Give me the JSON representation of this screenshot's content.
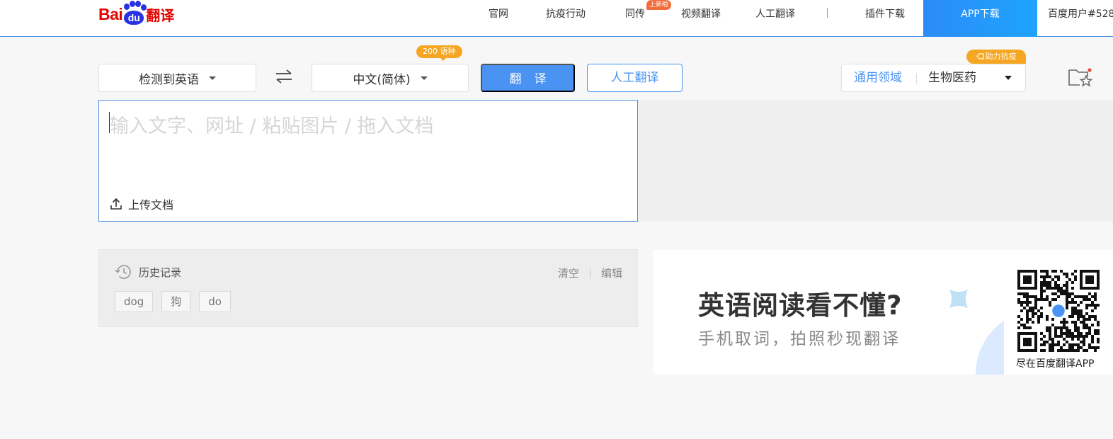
{
  "header": {
    "logo": {
      "bai": "Bai",
      "du": "du",
      "fanyi": "翻译"
    },
    "nav": [
      {
        "label": "官网"
      },
      {
        "label": "抗疫行动"
      },
      {
        "label": "同传",
        "badge": "上新啦"
      },
      {
        "label": "视频翻译"
      },
      {
        "label": "人工翻译"
      }
    ],
    "plugin_download": "插件下载",
    "app_download": "APP下载",
    "user": "百度用户#528",
    "accent_color": "#4a93f2"
  },
  "toolbar": {
    "source_lang": "检测到英语",
    "swap_icon": "swap-arrows-icon",
    "target_lang": "中文(简体)",
    "lang_count_badge": "200 语种",
    "translate_button": "翻译",
    "human_translate_button": "人工翻译",
    "domain": {
      "general": "通用领域",
      "selected": "生物医药"
    },
    "domain_badge": "助力抗疫",
    "favorites_icon": "folder-star-icon"
  },
  "input": {
    "placeholder": "输入文字、网址 / 粘贴图片 / 拖入文档",
    "value": "",
    "upload_label": "上传文档"
  },
  "history": {
    "title": "历史记录",
    "clear": "清空",
    "edit": "编辑",
    "items": [
      "dog",
      "狗",
      "do"
    ]
  },
  "ad": {
    "headline": "英语阅读看不懂?",
    "subline": "手机取词，拍照秒现翻译",
    "qr_caption": "尽在百度翻译APP"
  }
}
